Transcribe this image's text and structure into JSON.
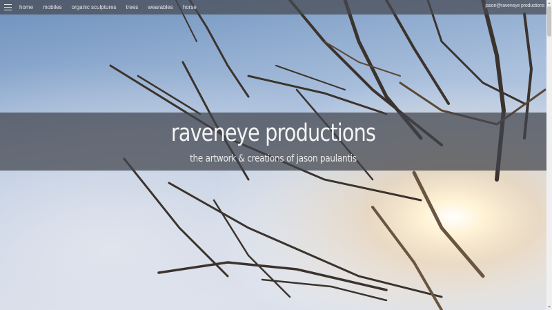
{
  "nav": {
    "items": [
      {
        "label": "home"
      },
      {
        "label": "mobiles"
      },
      {
        "label": "organic sculptures"
      },
      {
        "label": "trees"
      },
      {
        "label": "wearables"
      },
      {
        "label": "horse"
      }
    ],
    "menu_icon": "hamburger-menu-icon",
    "email": "jason@raveneye productions"
  },
  "hero": {
    "title": "raveneye productions",
    "subtitle": "the artwork & creations of jason paulantis"
  },
  "background": {
    "subject": "wire-sculpture-tree-photo",
    "colors": {
      "sky_top": "#6f93bf",
      "sky_bottom": "#c9d5e6",
      "sun": "#fff6dc",
      "wire": "#3e3630"
    }
  }
}
